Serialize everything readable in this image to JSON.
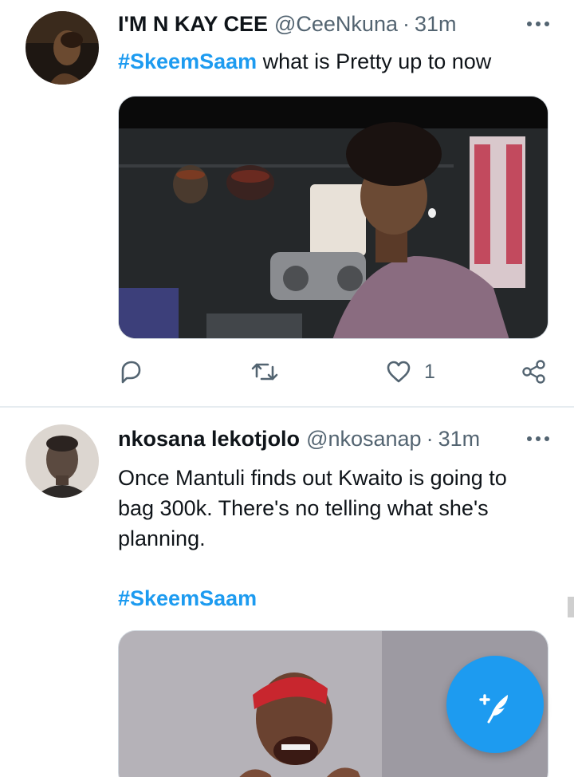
{
  "tweets": [
    {
      "author_name": "I'M N KAY CEE",
      "author_handle": "@CeeNkuna",
      "separator": "·",
      "time": "31m",
      "text_hashtag": "#SkeemSaam",
      "text_rest": " what is Pretty up to now",
      "media_icon": "video-still-image",
      "actions": {
        "reply_icon": "reply-icon",
        "retweet_icon": "retweet-icon",
        "like_icon": "like-icon",
        "like_count": "1",
        "share_icon": "share-icon"
      },
      "more_icon": "more-options-icon"
    },
    {
      "author_name": "nkosana lekotjolo",
      "author_handle": "@nkosanap",
      "separator": "·",
      "time": "31m",
      "text": "Once Mantuli finds out Kwaito is going to bag 300k. There's no telling what she's planning.",
      "hashtag": "#SkeemSaam",
      "media_icon": "photo-image",
      "more_icon": "more-options-icon"
    }
  ],
  "compose_button": {
    "icon": "compose-feather-icon"
  },
  "colors": {
    "accent": "#1d9bf0",
    "text_primary": "#0f1419",
    "text_secondary": "#536471",
    "divider": "#e6ecf0"
  }
}
